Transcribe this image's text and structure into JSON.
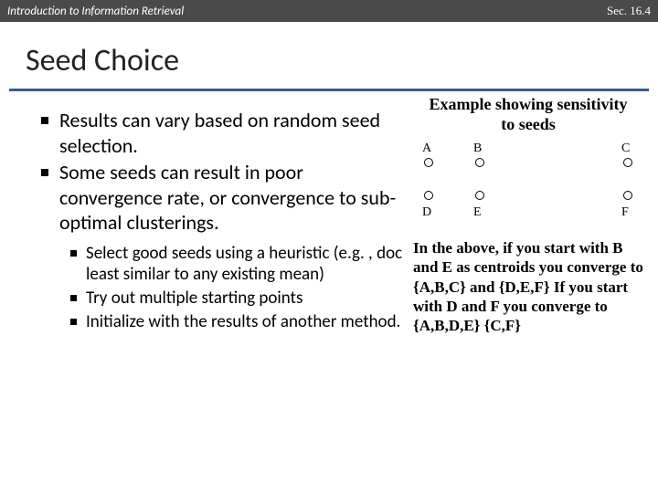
{
  "header": {
    "left": "Introduction to Information Retrieval",
    "right": "Sec. 16.4"
  },
  "title": "Seed Choice",
  "bullets": {
    "b1": "Results can vary based on random seed selection.",
    "b2": "Some seeds can result in poor convergence rate, or convergence to sub-optimal clusterings.",
    "s1": "Select good seeds using a heuristic (e.g. , doc least similar to any existing mean)",
    "s2": "Try out multiple starting points",
    "s3": "Initialize with the results of another method."
  },
  "example": {
    "title": "Example showing sensitivity to seeds",
    "points": {
      "A": "A",
      "B": "B",
      "C": "C",
      "D": "D",
      "E": "E",
      "F": "F"
    },
    "explain": "In the above, if you start with B and E as centroids you converge to {A,B,C} and {D,E,F} If you start with D and F you converge to {A,B,D,E} {C,F}"
  }
}
